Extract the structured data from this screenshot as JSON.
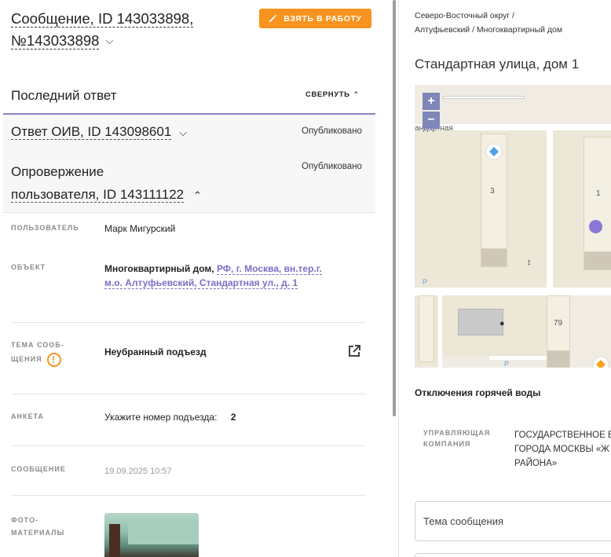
{
  "message": {
    "title_prefix": "Сообщение, ID 143033898,",
    "title_number": "№143033898",
    "take_button": "ВЗЯТЬ В РАБОТУ"
  },
  "last_answer": {
    "heading": "Последний ответ",
    "collapse_label": "СВЕРНУТЬ"
  },
  "responses": [
    {
      "title": "Ответ ОИВ, ID 143098601",
      "status": "Опубликовано"
    },
    {
      "title_line1": "Опровержение",
      "title_line2": "пользователя, ID 143111122",
      "status": "Опубликовано"
    }
  ],
  "details": {
    "user_label": "ПОЛЬЗОВАТЕЛЬ",
    "user_value": "Марк Мигурский",
    "object_label": "ОБЪЕКТ",
    "object_type": "Многоквартирный дом,",
    "object_address": "РФ, г. Москва, вн.тер.г. м.о. Алтуфьевский, Стандартная ул., д. 1",
    "topic_label_1": "ТЕМА СООБ-",
    "topic_label_2": "ЩЕНИЯ",
    "topic_value": "Неубранный подъезд",
    "survey_label": "АНКЕТА",
    "survey_question": "Укажите номер подъезда:",
    "survey_answer": "2",
    "message_label": "СООБЩЕНИЕ",
    "message_value": "19.09.2025 10:57",
    "photo_label_1": "ФОТО-",
    "photo_label_2": "МАТЕРИАЛЫ"
  },
  "location": {
    "crumb_1": "Северо-Восточный округ /",
    "crumb_2": "Алтуфьевский / Многоквартирный дом",
    "address": "Стандартная улица, дом 1",
    "map_street": "андартная",
    "map_house_3": "3",
    "map_house_1": "1",
    "map_house_79": "79",
    "map_p1": "P",
    "map_p2": "P",
    "zoom_in": "+",
    "zoom_out": "−",
    "hot_water": "Отключения горячей воды",
    "mgmt_label_1": "УПРАВЛЯЮЩАЯ",
    "mgmt_label_2": "КОМПАНИЯ",
    "mgmt_value_1": "ГОСУДАРСТВЕННОЕ Б",
    "mgmt_value_2": "ГОРОДА МОСКВЫ «Ж",
    "mgmt_value_3": "РАЙОНА»",
    "topic_placeholder": "Тема сообщения"
  },
  "colors": {
    "accent_orange": "#f7931e",
    "link_purple": "#7b6fc7",
    "border_purple": "#8c82c8"
  }
}
